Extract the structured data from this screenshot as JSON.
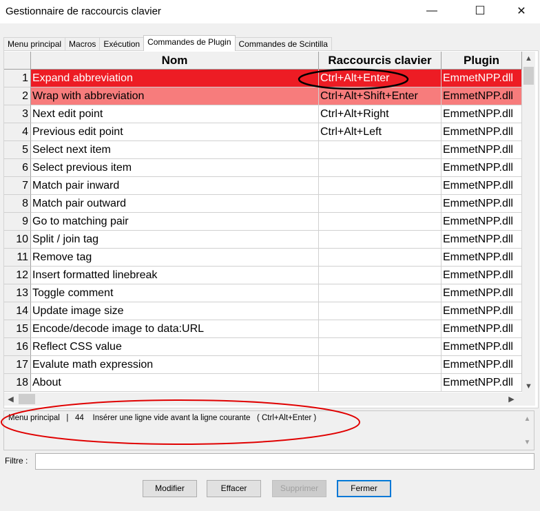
{
  "window": {
    "title": "Gestionnaire de raccourcis clavier",
    "minimize_glyph": "—",
    "maximize_glyph": "☐",
    "close_glyph": "✕"
  },
  "tabs": [
    {
      "label": "Menu principal"
    },
    {
      "label": "Macros"
    },
    {
      "label": "Exécution"
    },
    {
      "label": "Commandes de Plugin"
    },
    {
      "label": "Commandes de Scintilla"
    }
  ],
  "active_tab": "Commandes de Plugin",
  "table": {
    "headers": {
      "name": "Nom",
      "shortcut": "Raccourcis clavier",
      "plugin": "Plugin"
    },
    "rows": [
      {
        "n": "1",
        "name": "Expand abbreviation",
        "shortcut": "Ctrl+Alt+Enter",
        "plugin": "EmmetNPP.dll"
      },
      {
        "n": "2",
        "name": "Wrap with abbreviation",
        "shortcut": "Ctrl+Alt+Shift+Enter",
        "plugin": "EmmetNPP.dll"
      },
      {
        "n": "3",
        "name": "Next edit point",
        "shortcut": "Ctrl+Alt+Right",
        "plugin": "EmmetNPP.dll"
      },
      {
        "n": "4",
        "name": "Previous edit point",
        "shortcut": "Ctrl+Alt+Left",
        "plugin": "EmmetNPP.dll"
      },
      {
        "n": "5",
        "name": "Select next item",
        "shortcut": "",
        "plugin": "EmmetNPP.dll"
      },
      {
        "n": "6",
        "name": "Select previous item",
        "shortcut": "",
        "plugin": "EmmetNPP.dll"
      },
      {
        "n": "7",
        "name": "Match pair inward",
        "shortcut": "",
        "plugin": "EmmetNPP.dll"
      },
      {
        "n": "8",
        "name": "Match pair outward",
        "shortcut": "",
        "plugin": "EmmetNPP.dll"
      },
      {
        "n": "9",
        "name": "Go to matching pair",
        "shortcut": "",
        "plugin": "EmmetNPP.dll"
      },
      {
        "n": "10",
        "name": "Split / join tag",
        "shortcut": "",
        "plugin": "EmmetNPP.dll"
      },
      {
        "n": "11",
        "name": "Remove tag",
        "shortcut": "",
        "plugin": "EmmetNPP.dll"
      },
      {
        "n": "12",
        "name": "Insert formatted linebreak",
        "shortcut": "",
        "plugin": "EmmetNPP.dll"
      },
      {
        "n": "13",
        "name": "Toggle comment",
        "shortcut": "",
        "plugin": "EmmetNPP.dll"
      },
      {
        "n": "14",
        "name": "Update image size",
        "shortcut": "",
        "plugin": "EmmetNPP.dll"
      },
      {
        "n": "15",
        "name": "Encode/decode image to data:URL",
        "shortcut": "",
        "plugin": "EmmetNPP.dll"
      },
      {
        "n": "16",
        "name": "Reflect CSS value",
        "shortcut": "",
        "plugin": "EmmetNPP.dll"
      },
      {
        "n": "17",
        "name": "Evalute math expression",
        "shortcut": "",
        "plugin": "EmmetNPP.dll"
      },
      {
        "n": "18",
        "name": "About",
        "shortcut": "",
        "plugin": "EmmetNPP.dll"
      }
    ]
  },
  "scroll_arrows": {
    "up": "▲",
    "down": "▼",
    "left": "◀",
    "right": "▶"
  },
  "status": {
    "text": "Menu principal   |   44    Insérer une ligne vide avant la ligne courante   ( Ctrl+Alt+Enter )"
  },
  "filter": {
    "label": "Filtre :",
    "value": ""
  },
  "buttons": {
    "modify": "Modifier",
    "clear": "Effacer",
    "delete": "Supprimer",
    "close": "Fermer"
  },
  "colors": {
    "selected_row": "#ed1c24",
    "conflict_row": "#f77c7c",
    "annotation_black": "#000000",
    "annotation_red": "#e00000",
    "default_button_border": "#0078d7"
  }
}
